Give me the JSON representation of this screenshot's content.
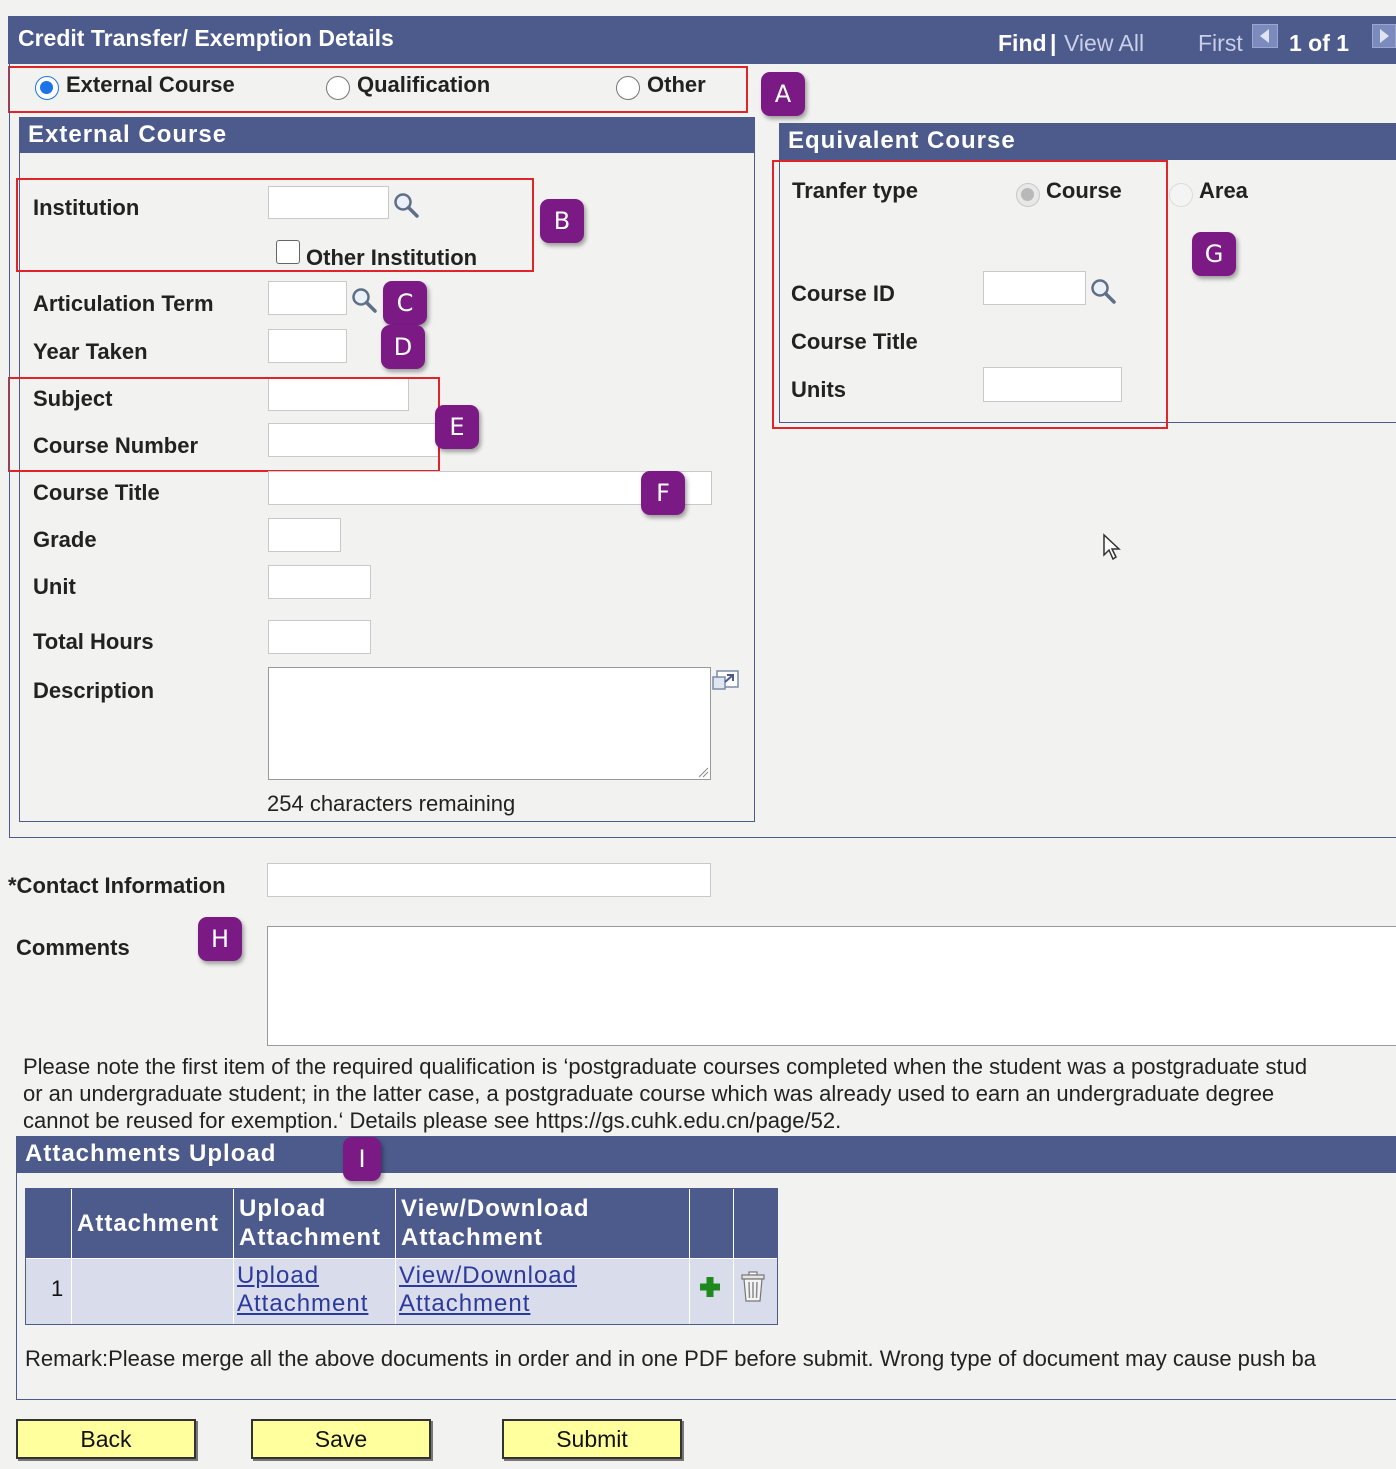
{
  "header": {
    "title": "Credit Transfer/ Exemption Details",
    "find": "Find",
    "separator": "|",
    "view_all": "View All",
    "first": "First",
    "page_count": "1 of 1"
  },
  "type_selector": {
    "options": [
      "External Course",
      "Qualification",
      "Other"
    ],
    "selected": "External Course"
  },
  "external_course": {
    "section_title": "External Course",
    "institution_label": "Institution",
    "other_institution_label": "Other Institution",
    "articulation_term_label": "Articulation Term",
    "year_taken_label": "Year Taken",
    "subject_label": "Subject",
    "course_number_label": "Course Number",
    "course_title_label": "Course Title",
    "grade_label": "Grade",
    "unit_label": "Unit",
    "total_hours_label": "Total Hours",
    "description_label": "Description",
    "chars_remaining": "254 characters remaining"
  },
  "equivalent_course": {
    "section_title": "Equivalent Course",
    "transfer_type_label": "Tranfer type",
    "course_option": "Course",
    "area_option": "Area",
    "course_id_label": "Course ID",
    "course_title_label": "Course Title",
    "units_label": "Units"
  },
  "contact": {
    "contact_label": "*Contact Information",
    "comments_label": "Comments"
  },
  "note": {
    "line1": "Please note the first item of the required qualification is ‘postgraduate courses completed when the student was a postgraduate stud",
    "line2": "or an undergraduate student; in the latter case, a postgraduate course which was already used to earn an undergraduate degree",
    "line3": "cannot be reused for exemption.‘ Details please see https://gs.cuhk.edu.cn/page/52."
  },
  "attachments": {
    "section_title": "Attachments Upload",
    "columns": [
      "Attachment",
      "Upload Attachment",
      "View/Download Attachment"
    ],
    "col_upload_line1": "Upload",
    "col_upload_line2": "Attachment",
    "col_view_line1": "View/Download",
    "col_view_line2": "Attachment",
    "rows": [
      {
        "row_number": "1",
        "attachment": "",
        "upload_line1": "Upload",
        "upload_line2": "Attachment",
        "view_line1": "View/Download",
        "view_line2": "Attachment"
      }
    ],
    "remark": "Remark:Please merge all the above documents in order and in one PDF before submit. Wrong type of document may cause push ba"
  },
  "buttons": {
    "back": "Back",
    "save": "Save",
    "submit": "Submit"
  },
  "annotations": [
    "A",
    "B",
    "C",
    "D",
    "E",
    "F",
    "G",
    "H",
    "I"
  ],
  "colors": {
    "header_bar": "#4c5a8c",
    "annotation_badge": "#7b1a84",
    "highlight_box": "#e0242a",
    "button_fill": "#ffff9e",
    "add_icon": "#1e8a1e"
  }
}
